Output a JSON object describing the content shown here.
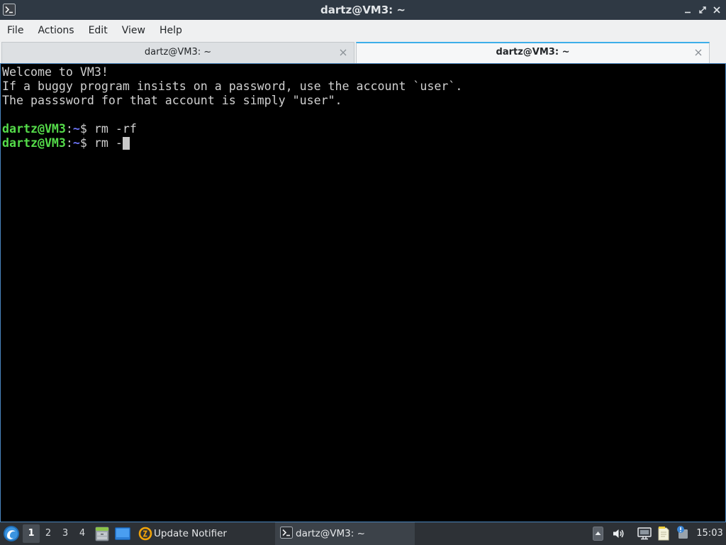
{
  "window": {
    "title": "dartz@VM3: ~",
    "app_icon": "terminal-icon",
    "controls": [
      {
        "icon": "minimize-icon"
      },
      {
        "icon": "maximize-icon"
      },
      {
        "icon": "close-icon"
      }
    ]
  },
  "menu": {
    "items": [
      {
        "label": "File"
      },
      {
        "label": "Actions"
      },
      {
        "label": "Edit"
      },
      {
        "label": "View"
      },
      {
        "label": "Help"
      }
    ]
  },
  "tabs": [
    {
      "label": "dartz@VM3: ~",
      "active": false,
      "close_icon": "close-tab-icon"
    },
    {
      "label": "dartz@VM3: ~",
      "active": true,
      "close_icon": "close-tab-icon"
    }
  ],
  "terminal": {
    "lines": [
      "Welcome to VM3!",
      "If a buggy program insists on a password, use the account `user`.",
      "The passsword for that account is simply \"user\"."
    ],
    "prompts": [
      {
        "user_host": "dartz@VM3",
        "separator": ":",
        "path": "~",
        "symbol": "$",
        "command": "rm -rf"
      },
      {
        "user_host": "dartz@VM3",
        "separator": ":",
        "path": "~",
        "symbol": "$",
        "command": "rm -"
      }
    ]
  },
  "taskbar": {
    "main_menu_icon": "lxqt-logo-icon",
    "desktops": [
      {
        "label": "1",
        "active": true
      },
      {
        "label": "2",
        "active": false
      },
      {
        "label": "3",
        "active": false
      },
      {
        "label": "4",
        "active": false
      }
    ],
    "quick_launch": [
      {
        "icon": "file-manager-icon"
      },
      {
        "icon": "show-desktop-icon"
      }
    ],
    "tasks": [
      {
        "label": "Update Notifier",
        "icon": "update-notifier-icon",
        "active": false
      },
      {
        "label": "dartz@VM3: ~",
        "icon": "terminal-icon",
        "active": true
      }
    ],
    "tray": [
      {
        "icon": "show-hidden-icons-icon"
      },
      {
        "icon": "volume-icon"
      },
      {
        "icon": "network-icon"
      },
      {
        "icon": "notes-icon"
      },
      {
        "icon": "notification-icon"
      }
    ],
    "clock": "15:03"
  },
  "colors": {
    "titlebar_bg": "#2f3944",
    "menubar_bg": "#eff0f1",
    "terminal_bg": "#000000",
    "terminal_fg": "#d0d0d0",
    "prompt_user": "#55dc4a",
    "prompt_path": "#6c74f6",
    "cursor": "#c8c8c8",
    "accent": "#3daee9",
    "taskbar_bg": "#2d3136",
    "taskbar_fg": "#e6e8ea"
  }
}
